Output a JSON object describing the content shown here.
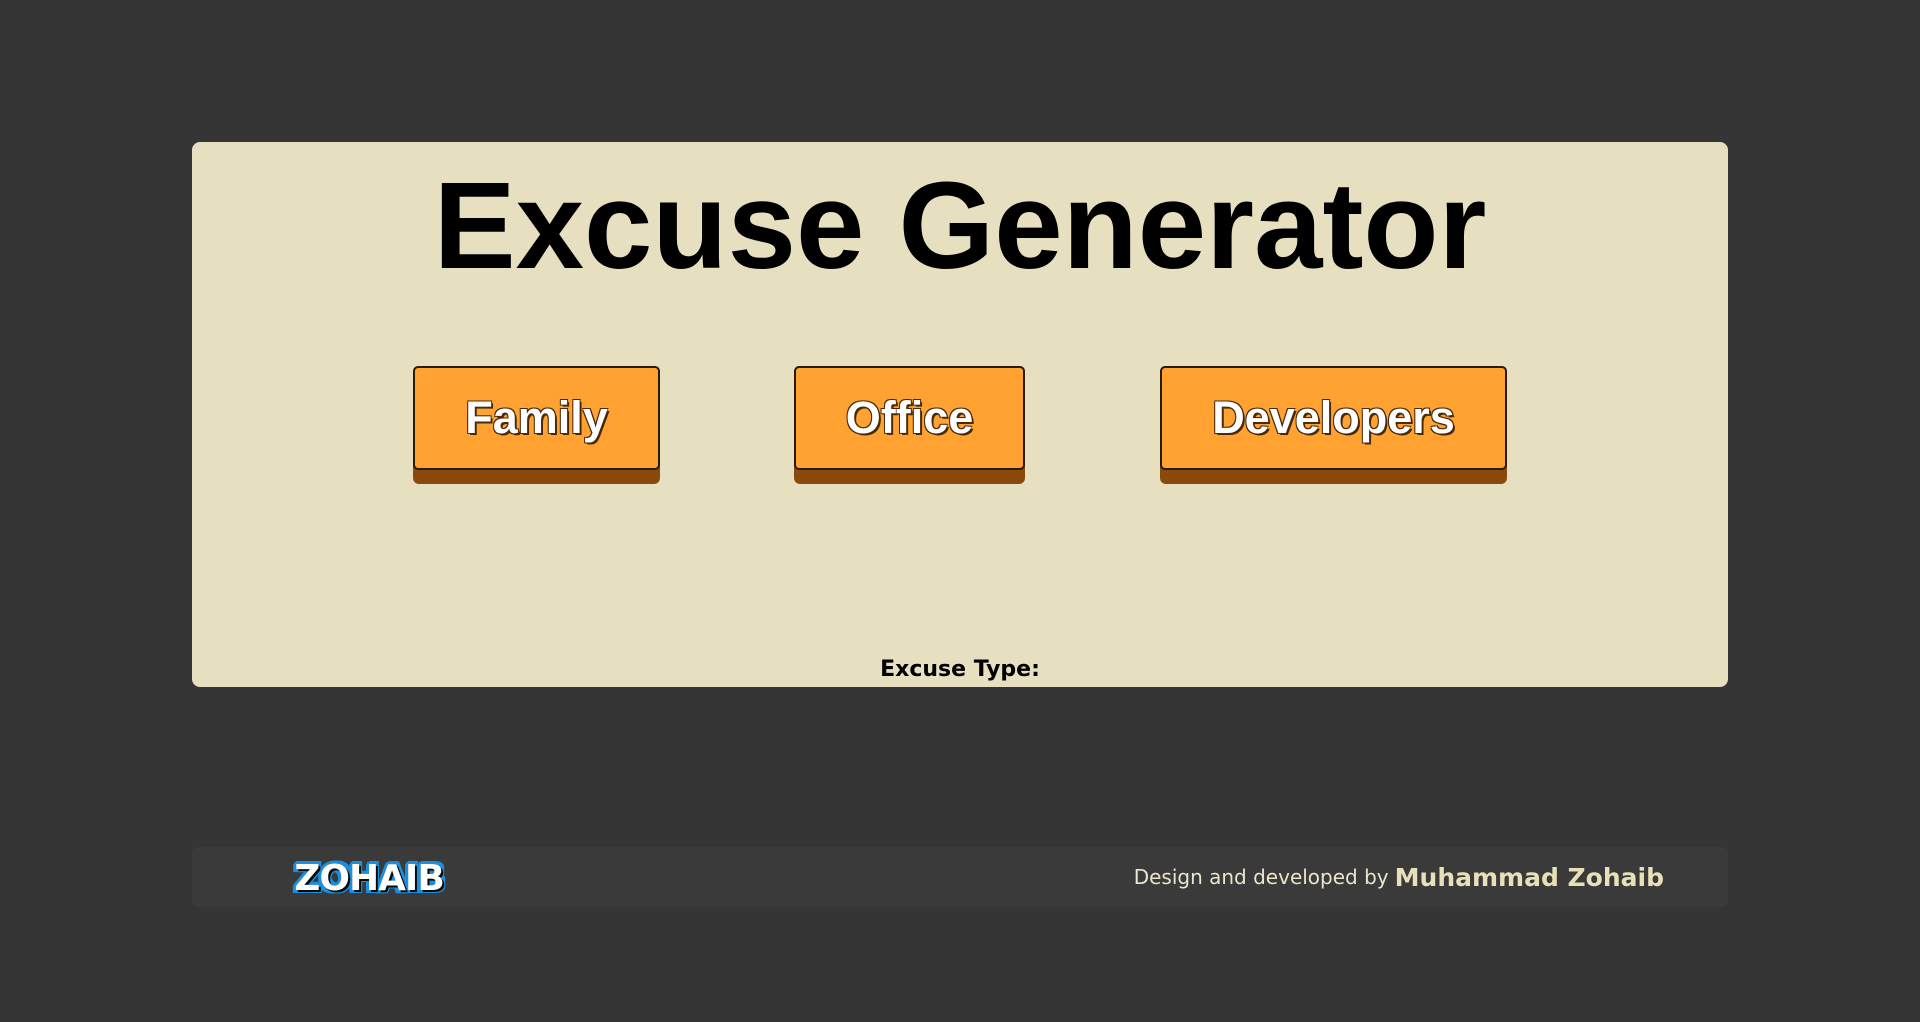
{
  "app": {
    "title": "Excuse Generator"
  },
  "buttons": {
    "family": "Family",
    "office": "Office",
    "developers": "Developers"
  },
  "result": {
    "excuse_type_label": "Excuse Type:"
  },
  "footer": {
    "logo_text": "ZOHAIB",
    "credit_prefix": "Design and developed by",
    "credit_name": "Muhammad Zohaib"
  },
  "colors": {
    "background": "#353535",
    "card": "#e6dfc0",
    "button": "#ffa231",
    "button_shadow": "#8a4a0c",
    "footer": "#3a3a3a"
  }
}
